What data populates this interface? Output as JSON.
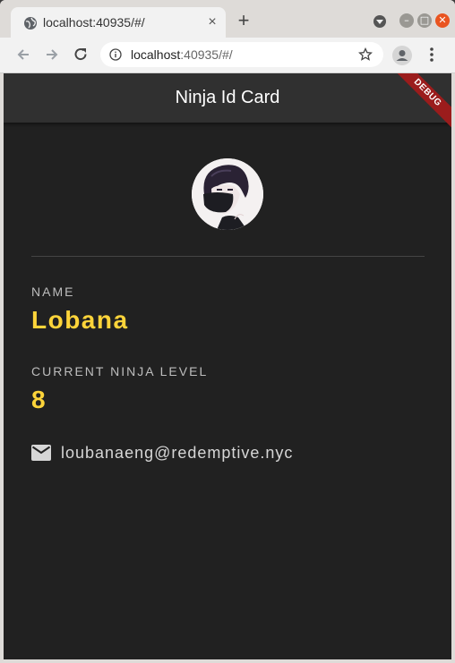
{
  "browser": {
    "tab_title": "localhost:40935/#/",
    "tab_close": "×",
    "new_tab": "+",
    "url_host": "localhost",
    "url_rest": ":40935/#/"
  },
  "app": {
    "title": "Ninja Id Card",
    "debug_banner": "DEBUG",
    "name_label": "NAME",
    "name_value": "Lobana",
    "level_label": "CURRENT NINJA LEVEL",
    "level_value": "8",
    "email": "loubanaeng@redemptive.nyc"
  },
  "colors": {
    "background": "#212121",
    "appbar": "#303030",
    "accent": "#fdd43a",
    "label": "#bdbdbd"
  },
  "icons": [
    "globe-icon",
    "back-icon",
    "forward-icon",
    "reload-icon",
    "info-icon",
    "star-icon",
    "account-icon",
    "menu-icon",
    "mail-icon"
  ]
}
